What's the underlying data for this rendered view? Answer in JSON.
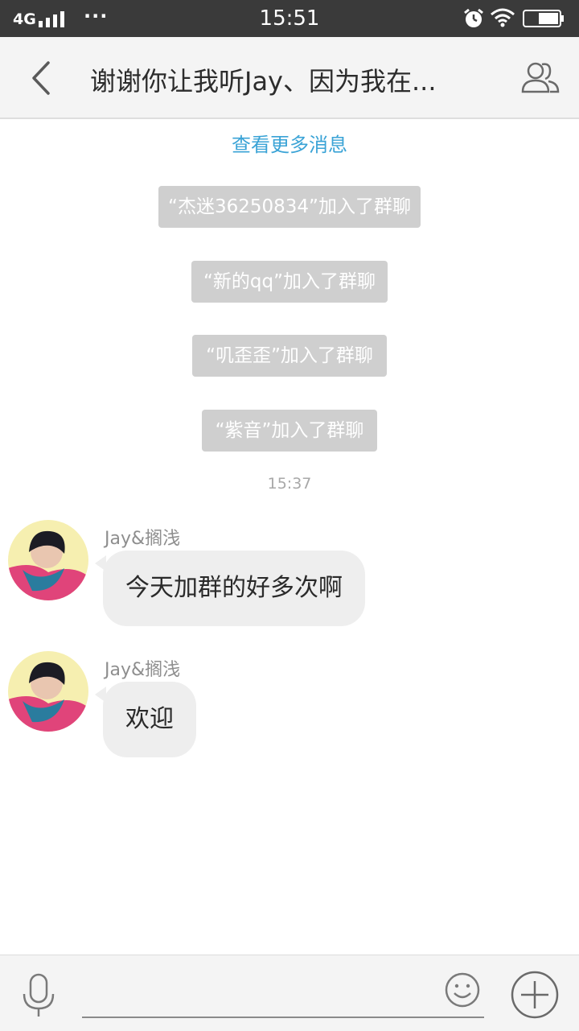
{
  "status_bar": {
    "network": "4G",
    "more": "···",
    "time": "15:51"
  },
  "header": {
    "title": "谢谢你让我听Jay、因为我在..."
  },
  "chat": {
    "load_more": "查看更多消息",
    "system_messages": [
      "“杰迷36250834”加入了群聊",
      "“新的qq”加入了群聊",
      "“叽歪歪”加入了群聊",
      "“紫音”加入了群聊"
    ],
    "timestamp": "15:37",
    "messages": [
      {
        "sender": "Jay&搁浅",
        "text": "今天加群的好多次啊"
      },
      {
        "sender": "Jay&搁浅",
        "text": "欢迎"
      }
    ]
  },
  "input": {
    "placeholder": ""
  },
  "colors": {
    "status_bar_bg": "#3a3a3a",
    "header_bg": "#f4f4f4",
    "link_blue": "#3aa3d6",
    "system_msg_bg": "#cfcfcf",
    "bubble_bg": "#eeeeee"
  }
}
